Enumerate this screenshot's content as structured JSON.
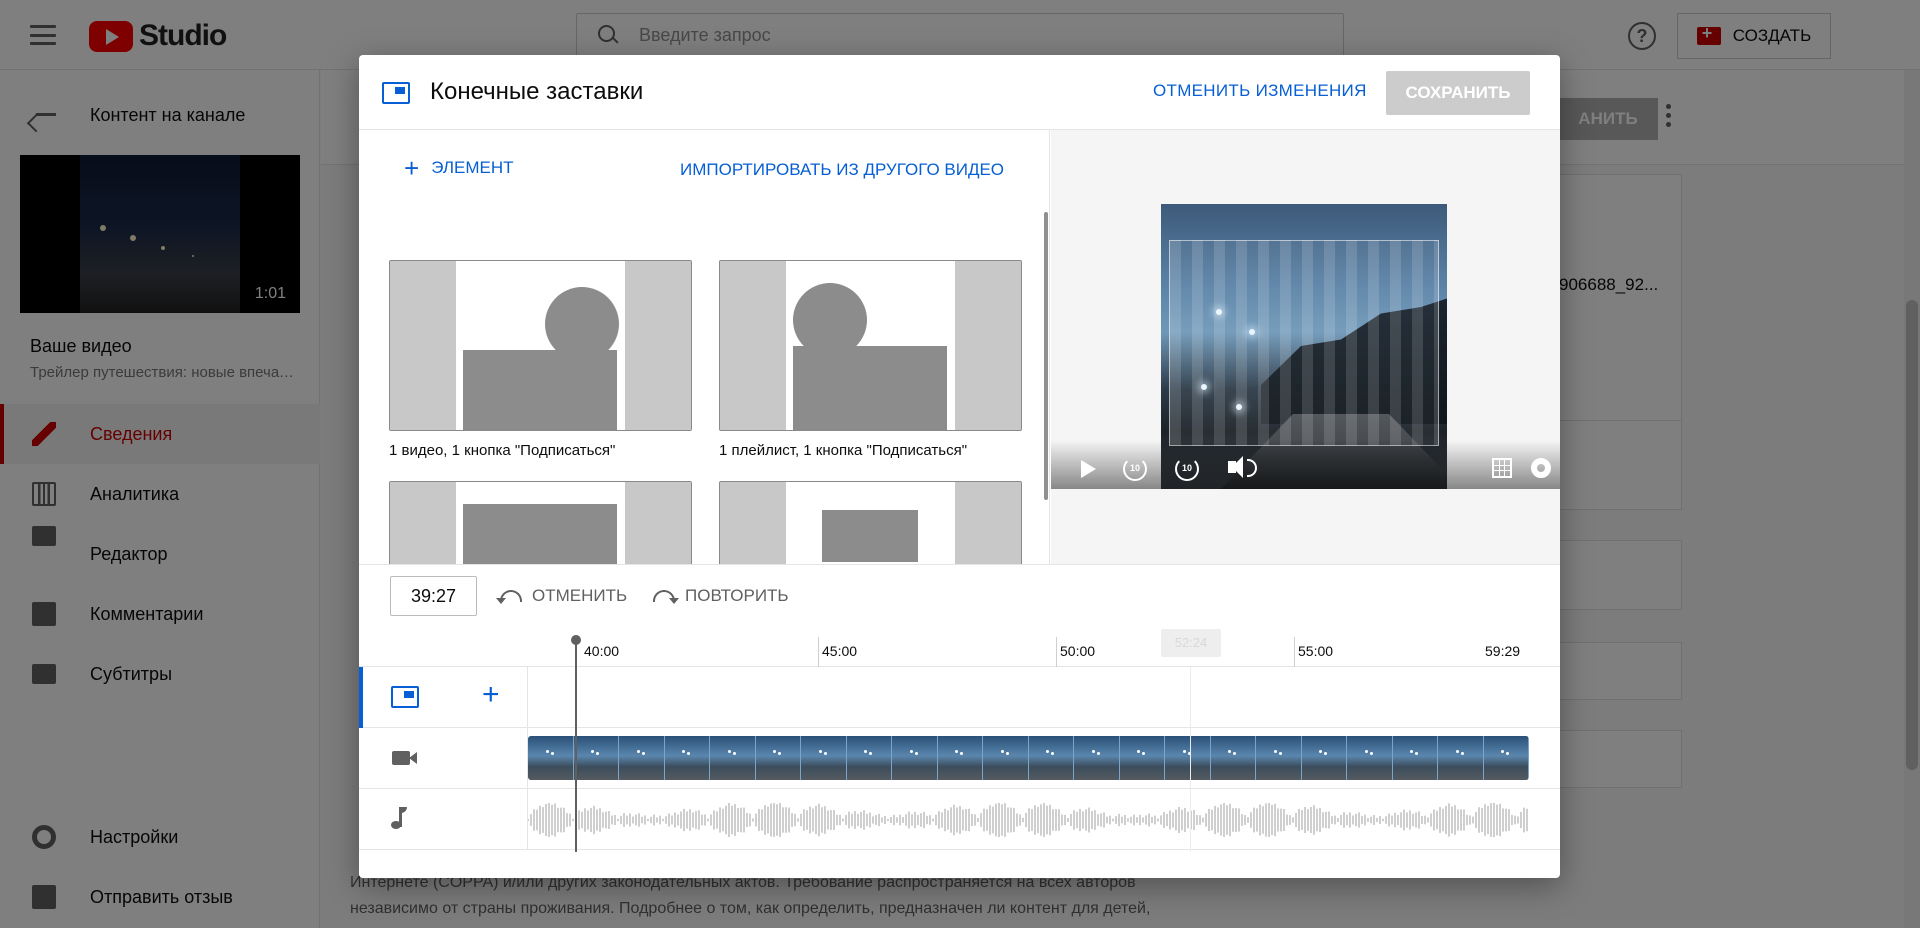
{
  "topbar": {
    "logo_text": "Studio",
    "search_placeholder": "Введите запрос",
    "help_label": "?",
    "create_label": "СОЗДАТЬ"
  },
  "sidebar": {
    "back_label": "Контент на канале",
    "thumbnail_duration": "1:01",
    "your_video": "Ваше видео",
    "video_title": "Трейлер путешествия: новые впечатления",
    "items": [
      {
        "label": "Сведения",
        "icon": "pencil-icon",
        "active": true
      },
      {
        "label": "Аналитика",
        "icon": "analytics-icon",
        "active": false
      },
      {
        "label": "Редактор",
        "icon": "editor-icon",
        "active": false
      },
      {
        "label": "Комментарии",
        "icon": "comments-icon",
        "active": false
      },
      {
        "label": "Субтитры",
        "icon": "subtitles-icon",
        "active": false
      }
    ],
    "bottom_items": [
      {
        "label": "Настройки",
        "icon": "gear-icon"
      },
      {
        "label": "Отправить отзыв",
        "icon": "feedback-icon"
      }
    ]
  },
  "page": {
    "save_label": "АНИТЬ",
    "filename_fragment": "906688_92...",
    "text_line_1": "Интернете (COPPA) и/или других законодательных актов. Требование распространяется на всех авторов",
    "text_line_2": "независимо от страны проживания. Подробнее о том, как определить, предназначен ли контент для детей,"
  },
  "modal": {
    "title": "Конечные заставки",
    "discard_label": "ОТМЕНИТЬ ИЗМЕНЕНИЯ",
    "save_label": "СОХРАНИТЬ",
    "add_element_label": "ЭЛЕМЕНТ",
    "import_label": "ИМПОРТИРОВАТЬ ИЗ ДРУГОГО ВИДЕО",
    "templates": [
      {
        "label": "1 видео, 1 кнопка \"Подписаться\""
      },
      {
        "label": "1 плейлист, 1 кнопка \"Подписаться\""
      },
      {
        "label": ""
      },
      {
        "label": ""
      }
    ],
    "toolbar": {
      "time_value": "39:27",
      "undo_label": "ОТМЕНИТЬ",
      "redo_label": "ПОВТОРИТЬ"
    },
    "ruler": {
      "ticks": [
        "40:00",
        "45:00",
        "50:00",
        "55:00",
        "59:29"
      ],
      "hover_time": "52:24"
    },
    "player": {
      "rewind_label": "10",
      "forward_label": "10"
    }
  }
}
